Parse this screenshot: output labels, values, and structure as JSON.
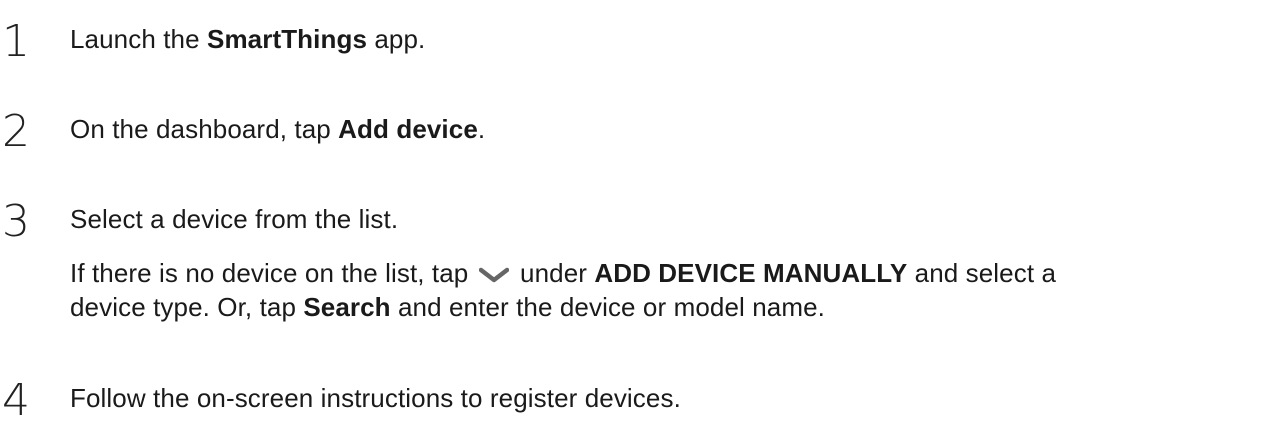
{
  "steps": [
    {
      "number": "1",
      "pre": "Launch the ",
      "bold": "SmartThings",
      "post": " app."
    },
    {
      "number": "2",
      "pre": "On the dashboard, tap ",
      "bold": "Add device",
      "post": "."
    },
    {
      "number": "3",
      "text": "Select a device from the list.",
      "note": {
        "line1_pre": "If there is no device on the list, tap",
        "icon": "chevron-down-icon",
        "line1_mid": " under ",
        "line1_bold": "ADD DEVICE MANUALLY",
        "line1_post": " and select a",
        "line2_pre": "device type. Or, tap ",
        "line2_bold": "Search",
        "line2_post": " and enter the device or model name."
      }
    },
    {
      "number": "4",
      "text": "Follow the on-screen instructions to register devices."
    }
  ],
  "colors": {
    "text": "#1a1a1a",
    "icon": "#666666"
  }
}
